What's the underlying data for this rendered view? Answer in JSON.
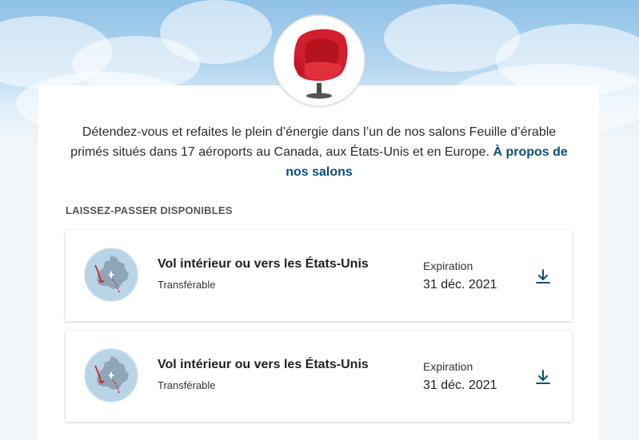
{
  "intro": {
    "text": "Détendez-vous et refaites le plein d’énergie dans l’un de nos salons Feuille d’érable primés situés dans 17 aéroports au Canada, aux États-Unis et en Europe. ",
    "link": "À propos de nos salons"
  },
  "section": {
    "title": "LAISSEZ-PASSER DISPONIBLES"
  },
  "passes": [
    {
      "title": "Vol intérieur ou vers les États-Unis",
      "subtitle": "Transférable",
      "expiration_label": "Expiration",
      "expiration_date": "31 déc. 2021",
      "icon": "download-icon"
    },
    {
      "title": "Vol intérieur ou vers les États-Unis",
      "subtitle": "Transférable",
      "expiration_label": "Expiration",
      "expiration_date": "31 déc. 2021",
      "icon": "download-icon"
    }
  ],
  "colors": {
    "link": "#0a4f7a",
    "chair": "#d11f2e",
    "map_bg": "#b9d4e6",
    "route": "#d9232e"
  }
}
